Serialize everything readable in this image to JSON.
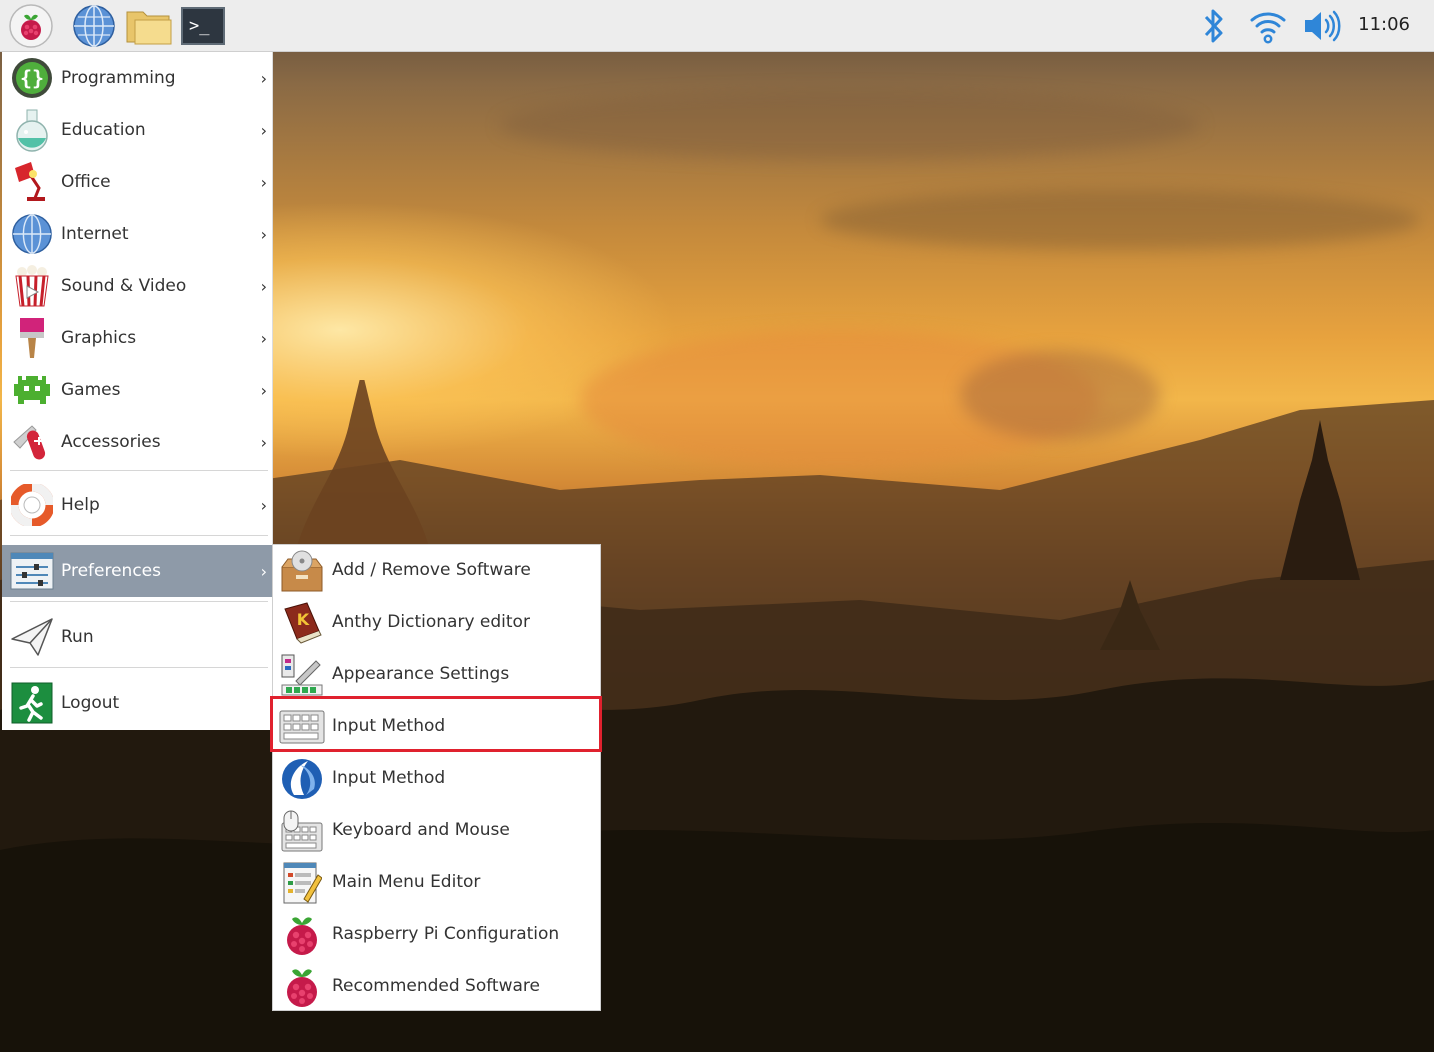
{
  "taskbar": {
    "launchers": [
      {
        "icon": "raspberry-menu-icon"
      },
      {
        "icon": "web-browser-icon"
      },
      {
        "icon": "file-manager-icon"
      },
      {
        "icon": "terminal-icon",
        "text": ">_"
      }
    ],
    "tray": {
      "bluetooth": "bluetooth-icon",
      "wifi": "wifi-icon",
      "volume": "volume-icon"
    },
    "clock": "11:06"
  },
  "menu": {
    "items": [
      {
        "label": "Programming",
        "icon": "programming-icon",
        "has_submenu": true
      },
      {
        "label": "Education",
        "icon": "education-flask-icon",
        "has_submenu": true
      },
      {
        "label": "Office",
        "icon": "office-lamp-icon",
        "has_submenu": true
      },
      {
        "label": "Internet",
        "icon": "internet-globe-icon",
        "has_submenu": true
      },
      {
        "label": "Sound & Video",
        "icon": "sound-video-popcorn-icon",
        "has_submenu": true
      },
      {
        "label": "Graphics",
        "icon": "graphics-brush-icon",
        "has_submenu": true
      },
      {
        "label": "Games",
        "icon": "games-invader-icon",
        "has_submenu": true
      },
      {
        "label": "Accessories",
        "icon": "accessories-knife-icon",
        "has_submenu": true
      },
      {
        "label": "Help",
        "icon": "help-lifebuoy-icon",
        "has_submenu": true
      },
      {
        "label": "Preferences",
        "icon": "preferences-sliders-icon",
        "has_submenu": true,
        "active": true
      },
      {
        "label": "Run",
        "icon": "run-paper-plane-icon",
        "has_submenu": false
      },
      {
        "label": "Logout",
        "icon": "logout-exit-icon",
        "has_submenu": false
      }
    ],
    "chevron": "›"
  },
  "preferences_submenu": {
    "items": [
      {
        "label": "Add / Remove Software",
        "icon": "package-box-icon"
      },
      {
        "label": "Anthy Dictionary editor",
        "icon": "dictionary-book-icon"
      },
      {
        "label": "Appearance Settings",
        "icon": "appearance-palette-icon"
      },
      {
        "label": "Input Method",
        "icon": "keyboard-grid-icon",
        "highlighted": true
      },
      {
        "label": "Input Method",
        "icon": "fcitx-input-icon"
      },
      {
        "label": "Keyboard and Mouse",
        "icon": "keyboard-mouse-icon"
      },
      {
        "label": "Main Menu Editor",
        "icon": "menu-editor-icon"
      },
      {
        "label": "Raspberry Pi Configuration",
        "icon": "raspberry-config-icon"
      },
      {
        "label": "Recommended Software",
        "icon": "raspberry-recommended-icon"
      }
    ]
  },
  "colors": {
    "menu_active_bg": "#8e9aa8",
    "highlight_border": "#e0212e",
    "taskbar_bg": "#ededed",
    "tray_icon_blue": "#2f86d8"
  }
}
